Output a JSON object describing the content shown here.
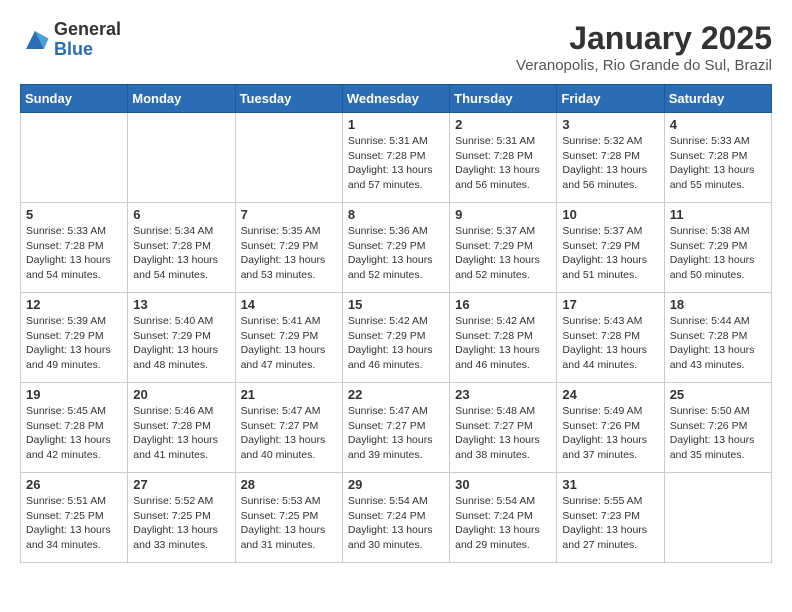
{
  "header": {
    "logo_general": "General",
    "logo_blue": "Blue",
    "title": "January 2025",
    "subtitle": "Veranopolis, Rio Grande do Sul, Brazil"
  },
  "weekdays": [
    "Sunday",
    "Monday",
    "Tuesday",
    "Wednesday",
    "Thursday",
    "Friday",
    "Saturday"
  ],
  "weeks": [
    [
      {
        "day": "",
        "sunrise": "",
        "sunset": "",
        "daylight": ""
      },
      {
        "day": "",
        "sunrise": "",
        "sunset": "",
        "daylight": ""
      },
      {
        "day": "",
        "sunrise": "",
        "sunset": "",
        "daylight": ""
      },
      {
        "day": "1",
        "sunrise": "5:31 AM",
        "sunset": "7:28 PM",
        "daylight": "13 hours and 57 minutes."
      },
      {
        "day": "2",
        "sunrise": "5:31 AM",
        "sunset": "7:28 PM",
        "daylight": "13 hours and 56 minutes."
      },
      {
        "day": "3",
        "sunrise": "5:32 AM",
        "sunset": "7:28 PM",
        "daylight": "13 hours and 56 minutes."
      },
      {
        "day": "4",
        "sunrise": "5:33 AM",
        "sunset": "7:28 PM",
        "daylight": "13 hours and 55 minutes."
      }
    ],
    [
      {
        "day": "5",
        "sunrise": "5:33 AM",
        "sunset": "7:28 PM",
        "daylight": "13 hours and 54 minutes."
      },
      {
        "day": "6",
        "sunrise": "5:34 AM",
        "sunset": "7:28 PM",
        "daylight": "13 hours and 54 minutes."
      },
      {
        "day": "7",
        "sunrise": "5:35 AM",
        "sunset": "7:29 PM",
        "daylight": "13 hours and 53 minutes."
      },
      {
        "day": "8",
        "sunrise": "5:36 AM",
        "sunset": "7:29 PM",
        "daylight": "13 hours and 52 minutes."
      },
      {
        "day": "9",
        "sunrise": "5:37 AM",
        "sunset": "7:29 PM",
        "daylight": "13 hours and 52 minutes."
      },
      {
        "day": "10",
        "sunrise": "5:37 AM",
        "sunset": "7:29 PM",
        "daylight": "13 hours and 51 minutes."
      },
      {
        "day": "11",
        "sunrise": "5:38 AM",
        "sunset": "7:29 PM",
        "daylight": "13 hours and 50 minutes."
      }
    ],
    [
      {
        "day": "12",
        "sunrise": "5:39 AM",
        "sunset": "7:29 PM",
        "daylight": "13 hours and 49 minutes."
      },
      {
        "day": "13",
        "sunrise": "5:40 AM",
        "sunset": "7:29 PM",
        "daylight": "13 hours and 48 minutes."
      },
      {
        "day": "14",
        "sunrise": "5:41 AM",
        "sunset": "7:29 PM",
        "daylight": "13 hours and 47 minutes."
      },
      {
        "day": "15",
        "sunrise": "5:42 AM",
        "sunset": "7:29 PM",
        "daylight": "13 hours and 46 minutes."
      },
      {
        "day": "16",
        "sunrise": "5:42 AM",
        "sunset": "7:28 PM",
        "daylight": "13 hours and 46 minutes."
      },
      {
        "day": "17",
        "sunrise": "5:43 AM",
        "sunset": "7:28 PM",
        "daylight": "13 hours and 44 minutes."
      },
      {
        "day": "18",
        "sunrise": "5:44 AM",
        "sunset": "7:28 PM",
        "daylight": "13 hours and 43 minutes."
      }
    ],
    [
      {
        "day": "19",
        "sunrise": "5:45 AM",
        "sunset": "7:28 PM",
        "daylight": "13 hours and 42 minutes."
      },
      {
        "day": "20",
        "sunrise": "5:46 AM",
        "sunset": "7:28 PM",
        "daylight": "13 hours and 41 minutes."
      },
      {
        "day": "21",
        "sunrise": "5:47 AM",
        "sunset": "7:27 PM",
        "daylight": "13 hours and 40 minutes."
      },
      {
        "day": "22",
        "sunrise": "5:47 AM",
        "sunset": "7:27 PM",
        "daylight": "13 hours and 39 minutes."
      },
      {
        "day": "23",
        "sunrise": "5:48 AM",
        "sunset": "7:27 PM",
        "daylight": "13 hours and 38 minutes."
      },
      {
        "day": "24",
        "sunrise": "5:49 AM",
        "sunset": "7:26 PM",
        "daylight": "13 hours and 37 minutes."
      },
      {
        "day": "25",
        "sunrise": "5:50 AM",
        "sunset": "7:26 PM",
        "daylight": "13 hours and 35 minutes."
      }
    ],
    [
      {
        "day": "26",
        "sunrise": "5:51 AM",
        "sunset": "7:25 PM",
        "daylight": "13 hours and 34 minutes."
      },
      {
        "day": "27",
        "sunrise": "5:52 AM",
        "sunset": "7:25 PM",
        "daylight": "13 hours and 33 minutes."
      },
      {
        "day": "28",
        "sunrise": "5:53 AM",
        "sunset": "7:25 PM",
        "daylight": "13 hours and 31 minutes."
      },
      {
        "day": "29",
        "sunrise": "5:54 AM",
        "sunset": "7:24 PM",
        "daylight": "13 hours and 30 minutes."
      },
      {
        "day": "30",
        "sunrise": "5:54 AM",
        "sunset": "7:24 PM",
        "daylight": "13 hours and 29 minutes."
      },
      {
        "day": "31",
        "sunrise": "5:55 AM",
        "sunset": "7:23 PM",
        "daylight": "13 hours and 27 minutes."
      },
      {
        "day": "",
        "sunrise": "",
        "sunset": "",
        "daylight": ""
      }
    ]
  ]
}
